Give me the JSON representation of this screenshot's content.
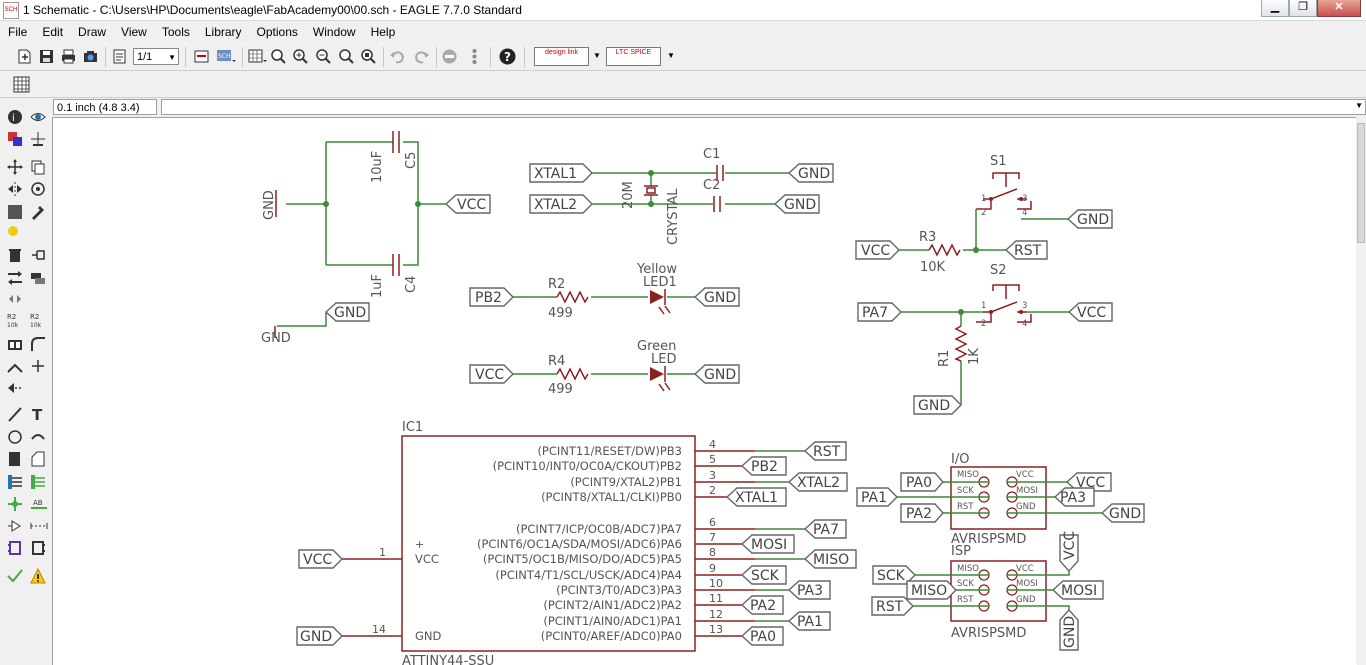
{
  "window": {
    "title": "1 Schematic - C:\\Users\\HP\\Documents\\eagle\\FabAcademy00\\00.sch - EAGLE 7.7.0 Standard",
    "app_icon_text": "SCH",
    "minimize_glyph": "▁",
    "maximize_glyph": "❐",
    "close_glyph": "✕"
  },
  "menu": [
    "File",
    "Edit",
    "Draw",
    "View",
    "Tools",
    "Library",
    "Options",
    "Window",
    "Help"
  ],
  "toolbar": {
    "sheet_combo": "1/1",
    "designlink_label": "design link",
    "ltspice_label": "LTC SPICE",
    "dropdown_glyph": "▼"
  },
  "cmdbar": {
    "coordinate": "0.1 inch (4.8 3.4)",
    "command": ""
  },
  "icons": {
    "grid": "grid-icon",
    "new": "open-file-icon",
    "save": "save-icon",
    "print": "print-icon",
    "cam": "cam-icon",
    "zoom": "zoom-icon",
    "undo": "undo-icon",
    "redo": "redo-icon",
    "stop": "stop-icon",
    "go": "go-icon",
    "help": "help-icon"
  },
  "colors": {
    "wire": "#3a8a3a",
    "net": "#3a8a3a",
    "symbol": "#8b2020",
    "label": "#555555",
    "junction": "#3a8a3a",
    "text": "#333333"
  },
  "schematic": {
    "caps": {
      "c5": {
        "name": "C5",
        "value": "10uF"
      },
      "c4": {
        "name": "C4",
        "value": "1uF"
      },
      "c1": {
        "name": "C1"
      },
      "c2": {
        "name": "C2"
      }
    },
    "crystal": {
      "name": "CRYSTAL",
      "value": "20M"
    },
    "resistors": {
      "r2": {
        "name": "R2",
        "value": "499"
      },
      "r4": {
        "name": "R4",
        "value": "499"
      },
      "r3": {
        "name": "R3",
        "value": "10K"
      },
      "r1": {
        "name": "R1",
        "value": "1K"
      }
    },
    "leds": {
      "led1": {
        "name": "LED1",
        "color": "Yellow"
      },
      "led": {
        "name": "LED",
        "color": "Green"
      }
    },
    "switches": {
      "s1": {
        "name": "S1",
        "pins": [
          "1",
          "2",
          "3",
          "4"
        ]
      },
      "s2": {
        "name": "S2",
        "pins": [
          "1",
          "2",
          "3",
          "4"
        ]
      }
    },
    "gnd_symbol_text": "GND",
    "labels": {
      "vcc_top": "VCC",
      "gnd_top": "GND",
      "xtal1": "XTAL1",
      "xtal2": "XTAL2",
      "gnd_c1": "GND",
      "gnd_c2": "GND",
      "gnd_s1": "GND",
      "vcc_r3": "VCC",
      "rst_r3": "RST",
      "pa7_s2": "PA7",
      "vcc_s2": "VCC",
      "gnd_r1": "GND",
      "pb2_r2": "PB2",
      "gnd_led1": "GND",
      "vcc_r4": "VCC",
      "gnd_led": "GND",
      "vcc_ic": "VCC",
      "gnd_ic": "GND",
      "rst_ic": "RST",
      "pb2_ic": "PB2",
      "xtal2_ic": "XTAL2",
      "xtal1_ic": "XTAL1",
      "pa7_ic": "PA7",
      "mosi_ic": "MOSI",
      "miso_ic": "MISO",
      "sck_ic": "SCK",
      "pa3_ic": "PA3",
      "pa2_ic": "PA2",
      "pa1_ic": "PA1",
      "pa0_ic": "PA0",
      "io_pa0": "PA0",
      "io_pa1": "PA1",
      "io_pa2": "PA2",
      "io_vcc": "VCC",
      "io_pa3": "PA3",
      "io_gnd": "GND",
      "isp_sck": "SCK",
      "isp_miso": "MISO",
      "isp_rst": "RST",
      "isp_vcc": "VCC",
      "isp_mosi": "MOSI",
      "isp_gnd": "GND"
    },
    "ic": {
      "name": "IC1",
      "value": "ATTINY44-SSU",
      "left_pins": [
        {
          "num": "1",
          "name": "VCC"
        },
        {
          "num": "14",
          "name": "GND"
        }
      ],
      "right_pins": [
        {
          "num": "4",
          "name": "(PCINT11/RESET/DW)PB3"
        },
        {
          "num": "5",
          "name": "(PCINT10/INT0/OC0A/CKOUT)PB2"
        },
        {
          "num": "3",
          "name": "(PCINT9/XTAL2)PB1"
        },
        {
          "num": "2",
          "name": "(PCINT8/XTAL1/CLKI)PB0"
        },
        {
          "num": "6",
          "name": "(PCINT7/ICP/OC0B/ADC7)PA7"
        },
        {
          "num": "7",
          "name": "(PCINT6/OC1A/SDA/MOSI/ADC6)PA6"
        },
        {
          "num": "8",
          "name": "(PCINT5/OC1B/MISO/DO/ADC5)PA5"
        },
        {
          "num": "9",
          "name": "(PCINT4/T1/SCL/USCK/ADC4)PA4"
        },
        {
          "num": "10",
          "name": "(PCINT3/T0/ADC3)PA3"
        },
        {
          "num": "11",
          "name": "(PCINT2/AIN1/ADC2)PA2"
        },
        {
          "num": "12",
          "name": "(PCINT1/AIN0/ADC1)PA1"
        },
        {
          "num": "13",
          "name": "(PCINT0/AREF/ADC0)PA0"
        }
      ]
    },
    "headers": {
      "io": {
        "name": "I/O",
        "value": "AVRISPSMD",
        "left": [
          "MISO",
          "SCK",
          "RST"
        ],
        "right": [
          "VCC",
          "MOSI",
          "GND"
        ]
      },
      "isp": {
        "name": "ISP",
        "value": "AVRISPSMD",
        "left": [
          "MISO",
          "SCK",
          "RST"
        ],
        "right": [
          "VCC",
          "MOSI",
          "GND"
        ]
      }
    }
  }
}
